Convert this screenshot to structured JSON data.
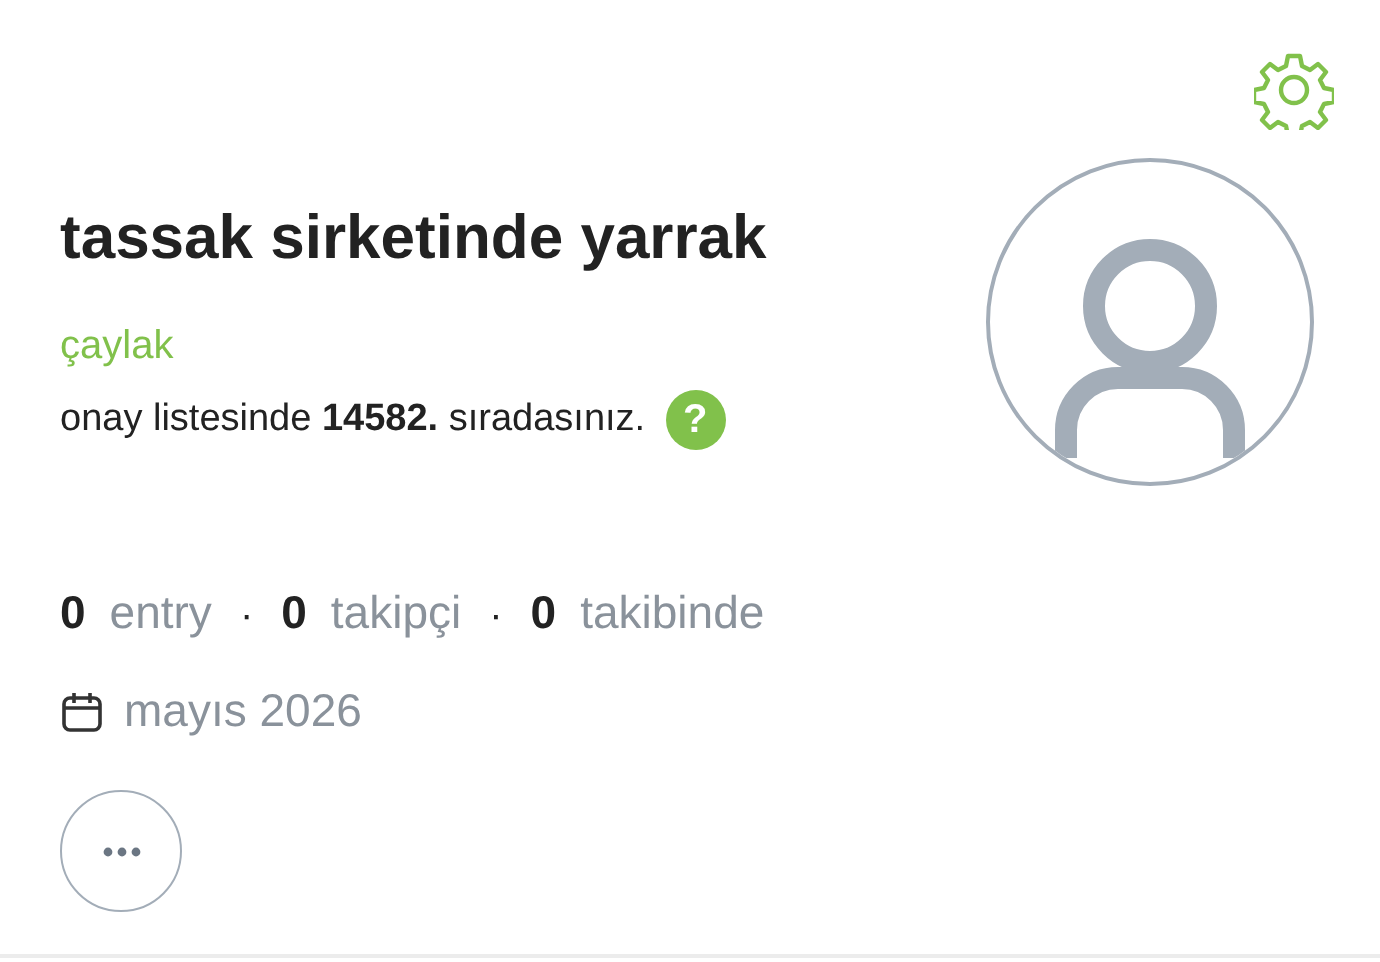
{
  "profile": {
    "username": "tassak sirketinde yarrak",
    "rank": "çaylak",
    "queue_text": "onay listesinde **14582.** sıradasınız.",
    "help_badge": "?"
  },
  "stats": [
    {
      "count": "0",
      "label": "entry"
    },
    {
      "count": "0",
      "label": "takipçi"
    },
    {
      "count": "0",
      "label": "takibinde"
    }
  ],
  "stats_separator": "·",
  "joined": "mayıs 2026"
}
